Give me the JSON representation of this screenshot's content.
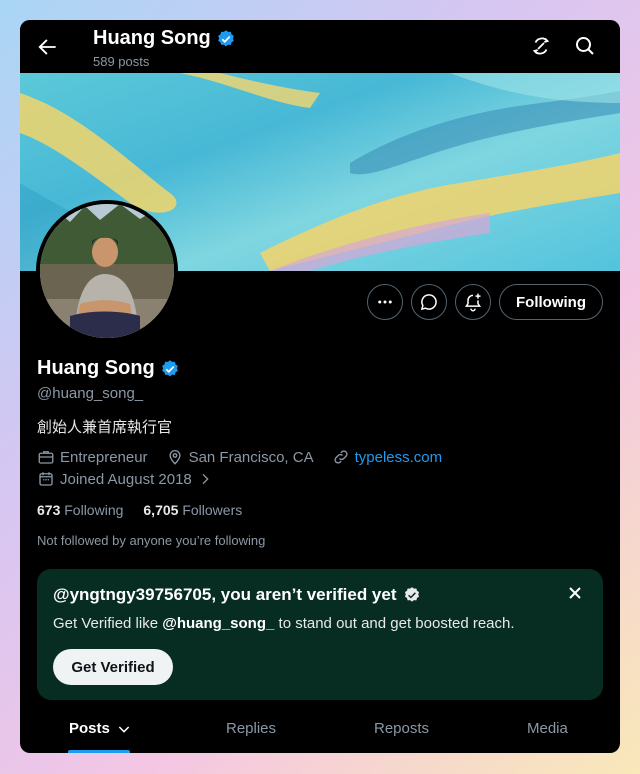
{
  "header": {
    "title": "Huang Song",
    "posts_count": "589 posts"
  },
  "profile": {
    "name": "Huang Song",
    "handle": "@huang_song_",
    "bio": "創始人兼首席執行官",
    "category": "Entrepreneur",
    "location": "San Francisco, CA",
    "website": "typeless.com",
    "joined": "Joined August 2018",
    "following_count": "673",
    "following_label": "Following",
    "followers_count": "6,705",
    "followers_label": "Followers",
    "not_followed_text": "Not followed by anyone you’re following"
  },
  "actions": {
    "following_button": "Following",
    "more_icon": "more-icon",
    "message_icon": "message-icon",
    "notify_icon": "bell-plus-icon"
  },
  "verify_card": {
    "title": "@yngtngy39756705, you aren’t verified yet",
    "text_prefix": "Get Verified like ",
    "text_handle": "@huang_song_",
    "text_suffix": " to stand out and get boosted reach.",
    "button": "Get Verified"
  },
  "tabs": [
    {
      "label": "Posts",
      "active": true
    },
    {
      "label": "Replies",
      "active": false
    },
    {
      "label": "Reposts",
      "active": false
    },
    {
      "label": "Media",
      "active": false
    }
  ],
  "colors": {
    "accent": "#1d9bf0",
    "background": "#000000",
    "verify_card_bg": "#072d22",
    "muted_text": "#8b98a5"
  }
}
